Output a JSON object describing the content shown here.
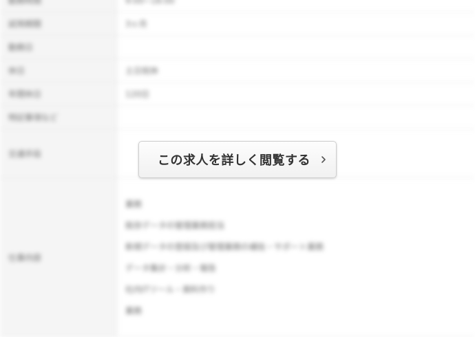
{
  "background_rows": [
    {
      "label": "勤務時間",
      "value": "9:00~18:00"
    },
    {
      "label": "試用期間",
      "value": "3ヶ月"
    },
    {
      "label": "勤務日",
      "value": ""
    },
    {
      "label": "休日",
      "value": "土日祝休"
    },
    {
      "label": "年間休日",
      "value": "120日"
    },
    {
      "label": "特記事項など",
      "value": ""
    },
    {
      "label": "交通手段",
      "value": ""
    },
    {
      "label": "仕事内容",
      "value": ""
    }
  ],
  "background_multi_lines": [
    "業務",
    "既存データの管理業務担当",
    "新規データの登録及び管理業務の補佐・サポート業務",
    "データ集計・分析・報告",
    "社内ITツール・資料作り",
    "業務"
  ],
  "cta": {
    "label": "この求人を詳しく閲覧する",
    "icon": "chevron-right-icon"
  }
}
